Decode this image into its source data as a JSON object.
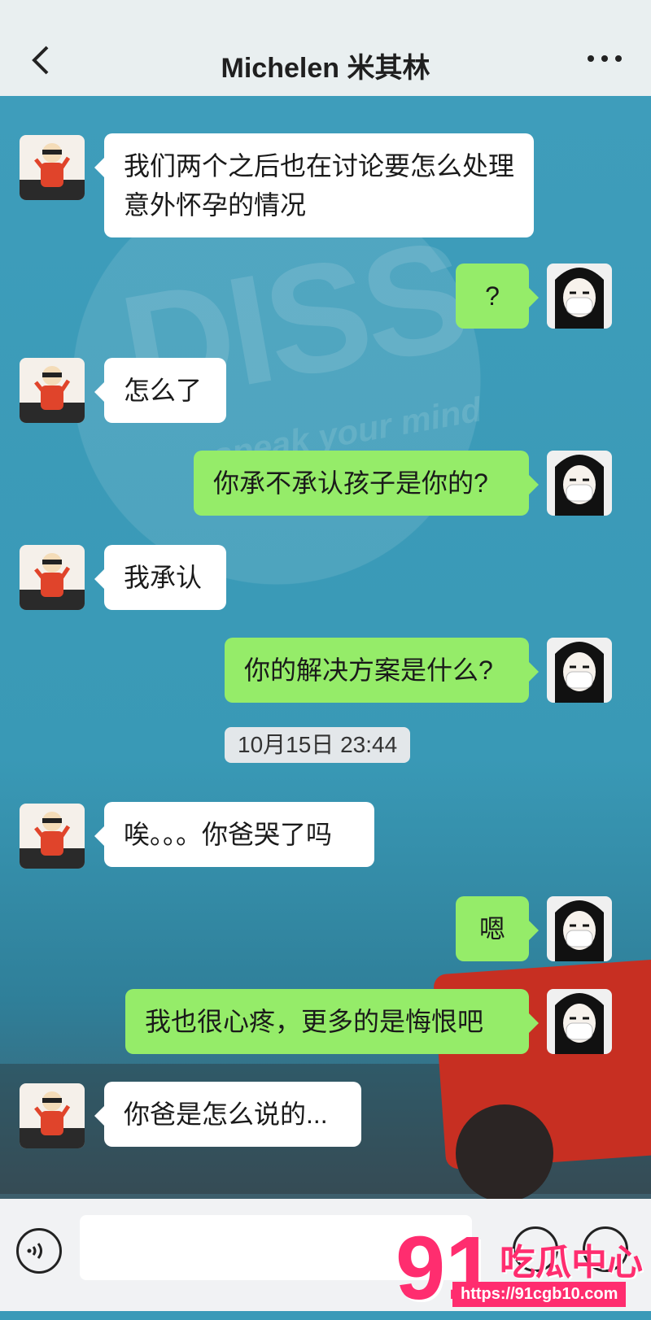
{
  "header": {
    "title": "Michelen 米其林",
    "back_icon": "back-icon",
    "more_icon": "more-icon"
  },
  "background_watermark": {
    "main": "DISS",
    "sub": "speak your mind"
  },
  "messages": [
    {
      "side": "left",
      "text": "我们两个之后也在讨论要怎么处理意外怀孕的情况"
    },
    {
      "side": "right",
      "text": "?"
    },
    {
      "side": "left",
      "text": "怎么了"
    },
    {
      "side": "right",
      "text": "你承不承认孩子是你的?"
    },
    {
      "side": "left",
      "text": "我承认"
    },
    {
      "side": "right",
      "text": "你的解决方案是什么?"
    },
    {
      "side": "left",
      "text": "唉。。。你爸哭了吗"
    },
    {
      "side": "right",
      "text": "嗯"
    },
    {
      "side": "right",
      "text": "我也很心疼，更多的是悔恨吧"
    },
    {
      "side": "left",
      "text": "你爸是怎么说的..."
    }
  ],
  "timestamps": [
    "10月15日 23:44"
  ],
  "input_bar": {
    "voice_icon": "voice-icon",
    "emoji_icon": "emoji-icon",
    "plus_icon": "plus-icon",
    "input_value": ""
  },
  "overlay_watermark": {
    "number": "91",
    "chinese": "吃瓜中心",
    "url": "https://91cgb10.com"
  },
  "colors": {
    "right_bubble": "#95ec69",
    "left_bubble": "#ffffff",
    "watermark": "#ff2d6f"
  }
}
